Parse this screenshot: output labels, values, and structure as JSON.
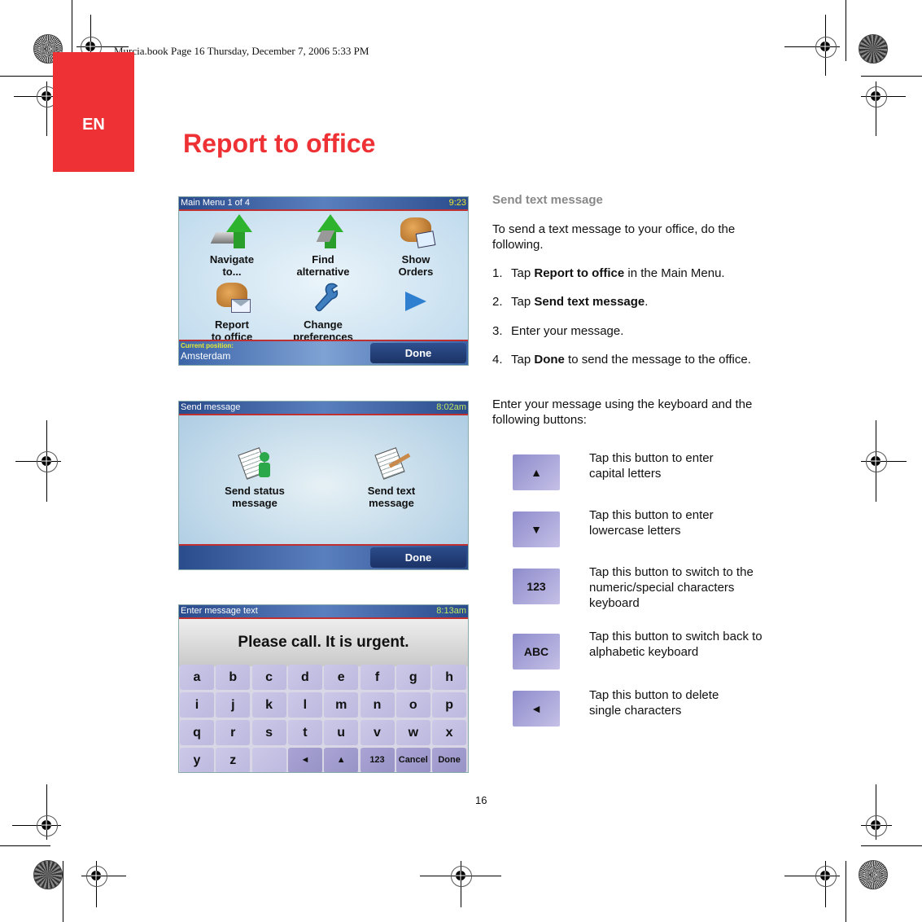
{
  "print_slug": "Murcia.book  Page 16  Thursday, December 7, 2006  5:33 PM",
  "language_tab": "EN",
  "page_title": "Report to office",
  "page_number": "16",
  "colors": {
    "accent_red": "#ee3135",
    "section_head_gray": "#888888",
    "device_titlebar_blue": "#2a4b8c",
    "key_lavender": "#c4c0e6"
  },
  "screens": {
    "main_menu": {
      "title": "Main Menu 1 of 4",
      "clock": "9:23",
      "items": [
        {
          "label_line1": "Navigate",
          "label_line2": "to...",
          "icon": "navigate-arrow-icon"
        },
        {
          "label_line1": "Find",
          "label_line2": "alternative",
          "icon": "find-alternative-icon"
        },
        {
          "label_line1": "Show",
          "label_line2": "Orders",
          "icon": "gloves-clipboard-icon"
        },
        {
          "label_line1": "Report",
          "label_line2": "to office",
          "icon": "gloves-envelope-icon"
        },
        {
          "label_line1": "Change",
          "label_line2": "preferences",
          "icon": "wrench-icon"
        }
      ],
      "next_icon": "next-page-arrow-icon",
      "current_position_label": "Current position:",
      "current_position_value": "Amsterdam",
      "done_label": "Done"
    },
    "send_message": {
      "title": "Send message",
      "clock": "8:02am",
      "options": [
        {
          "label_line1": "Send status",
          "label_line2": "message",
          "icon": "status-message-icon"
        },
        {
          "label_line1": "Send text",
          "label_line2": "message",
          "icon": "text-message-icon"
        }
      ],
      "done_label": "Done"
    },
    "enter_text": {
      "title": "Enter message text",
      "clock": "8:13am",
      "message": "Please call. It is urgent.",
      "rows": [
        [
          "a",
          "b",
          "c",
          "d",
          "e",
          "f",
          "g",
          "h"
        ],
        [
          "i",
          "j",
          "k",
          "l",
          "m",
          "n",
          "o",
          "p"
        ],
        [
          "q",
          "r",
          "s",
          "t",
          "u",
          "v",
          "w",
          "x"
        ]
      ],
      "last_row": {
        "letters": [
          "y",
          "z",
          ""
        ],
        "functions": [
          "◄",
          "▲",
          "123",
          "Cancel",
          "Done"
        ]
      }
    }
  },
  "section": {
    "heading": "Send text message",
    "intro": "To send a text message to your office, do the following.",
    "steps": [
      {
        "num": "1.",
        "pre": "Tap ",
        "bold": "Report to office",
        "post": " in the Main Menu."
      },
      {
        "num": "2.",
        "pre": "Tap ",
        "bold": "Send text message",
        "post": "."
      },
      {
        "num": "3.",
        "pre": "Enter your message.",
        "bold": "",
        "post": ""
      },
      {
        "num": "4.",
        "pre": "Tap ",
        "bold": "Done",
        "post": " to send the message to the office."
      }
    ],
    "keyboard_intro": "Enter your message using the keyboard and the following buttons:",
    "buttons": [
      {
        "glyph": "▲",
        "icon": "shift-up-icon",
        "description": "Tap this button to enter capital letters"
      },
      {
        "glyph": "▼",
        "icon": "shift-down-icon",
        "description": "Tap this button to enter lowercase letters"
      },
      {
        "glyph": "123",
        "icon": "numeric-keyboard-icon",
        "description": "Tap this button to switch to the numeric/special characters keyboard"
      },
      {
        "glyph": "ABC",
        "icon": "alphabetic-keyboard-icon",
        "description": "Tap this button to switch back to alphabetic keyboard"
      },
      {
        "glyph": "◄",
        "icon": "backspace-icon",
        "description": "Tap this button to delete single characters"
      }
    ]
  }
}
